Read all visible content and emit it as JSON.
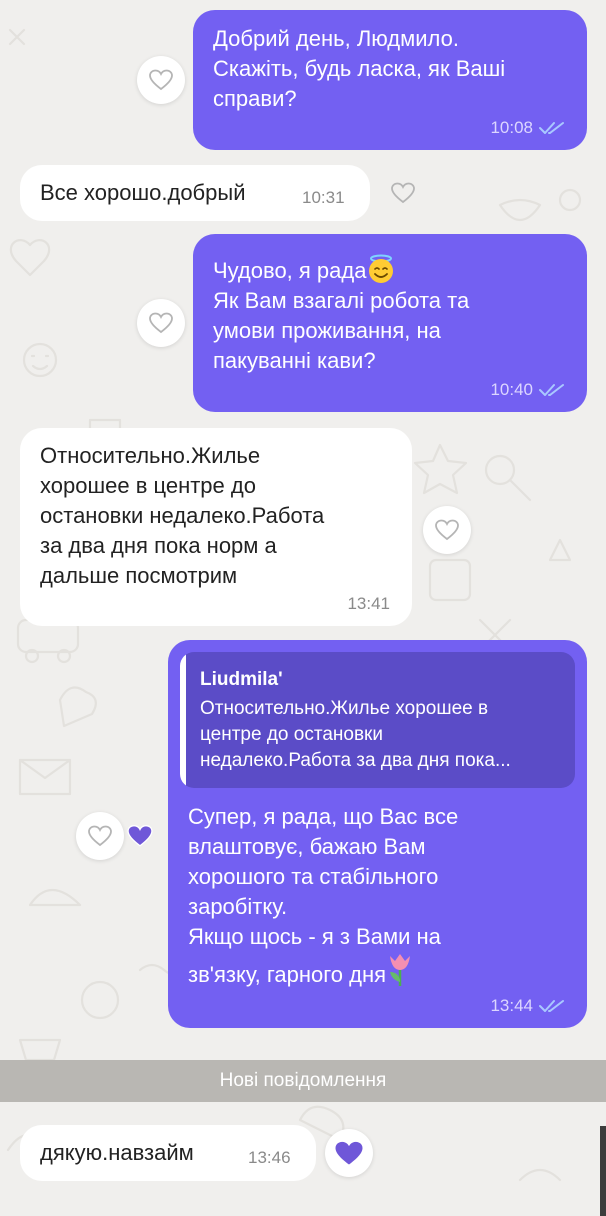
{
  "messages": [
    {
      "id": "m1",
      "direction": "outgoing",
      "text": "Добрий день, Людмило.\nСкажіть, будь ласка, як Ваші\nсправи?",
      "time": "10:08",
      "status": "read"
    },
    {
      "id": "m2",
      "direction": "incoming",
      "text": "Все хорошо.добрый",
      "time": "10:31"
    },
    {
      "id": "m3",
      "direction": "outgoing",
      "text": "Чудово, я рада",
      "text_emoji": "smiling-face-with-halo",
      "text_cont": "Як Вам взагалі робота та\nумови проживання, на\nпакуванні кави?",
      "time": "10:40",
      "status": "read"
    },
    {
      "id": "m4",
      "direction": "incoming",
      "text": "Относительно.Жилье\nхорошее в центре до\nостановки недалеко.Работа\nза два дня пока норм а\nдальше посмотрим",
      "time": "13:41"
    },
    {
      "id": "m5",
      "direction": "outgoing",
      "quote": {
        "author": "Liudmila'",
        "text": "Относительно.Жилье хорошее в\nцентре до остановки\nнедалеко.Работа за два дня пока..."
      },
      "text": "Супер, я рада, що Вас все\nвлаштовує, бажаю Вам\nхорошого та стабільного\nзаробітку.\nЯкщо щось - я з Вами на\nзв'язку, гарного дня",
      "text_emoji": "tulip",
      "time": "13:44",
      "status": "read",
      "liked": true
    },
    {
      "id": "m6",
      "direction": "incoming",
      "text": "дякую.навзайм",
      "time": "13:46",
      "liked": true
    }
  ],
  "new_messages_label": "Нові повідомлення",
  "colors": {
    "outgoing_bubble": "#7360f2",
    "incoming_bubble": "#ffffff",
    "quote_bg": "#5b4cc7",
    "like_filled": "#6f57d8",
    "read_ticks": "#a9c8ff",
    "background": "#f0efed",
    "divider": "#b9b7b3"
  },
  "icons": {
    "like": "heart-outline-icon",
    "liked": "heart-filled-icon",
    "read": "double-check-icon"
  }
}
